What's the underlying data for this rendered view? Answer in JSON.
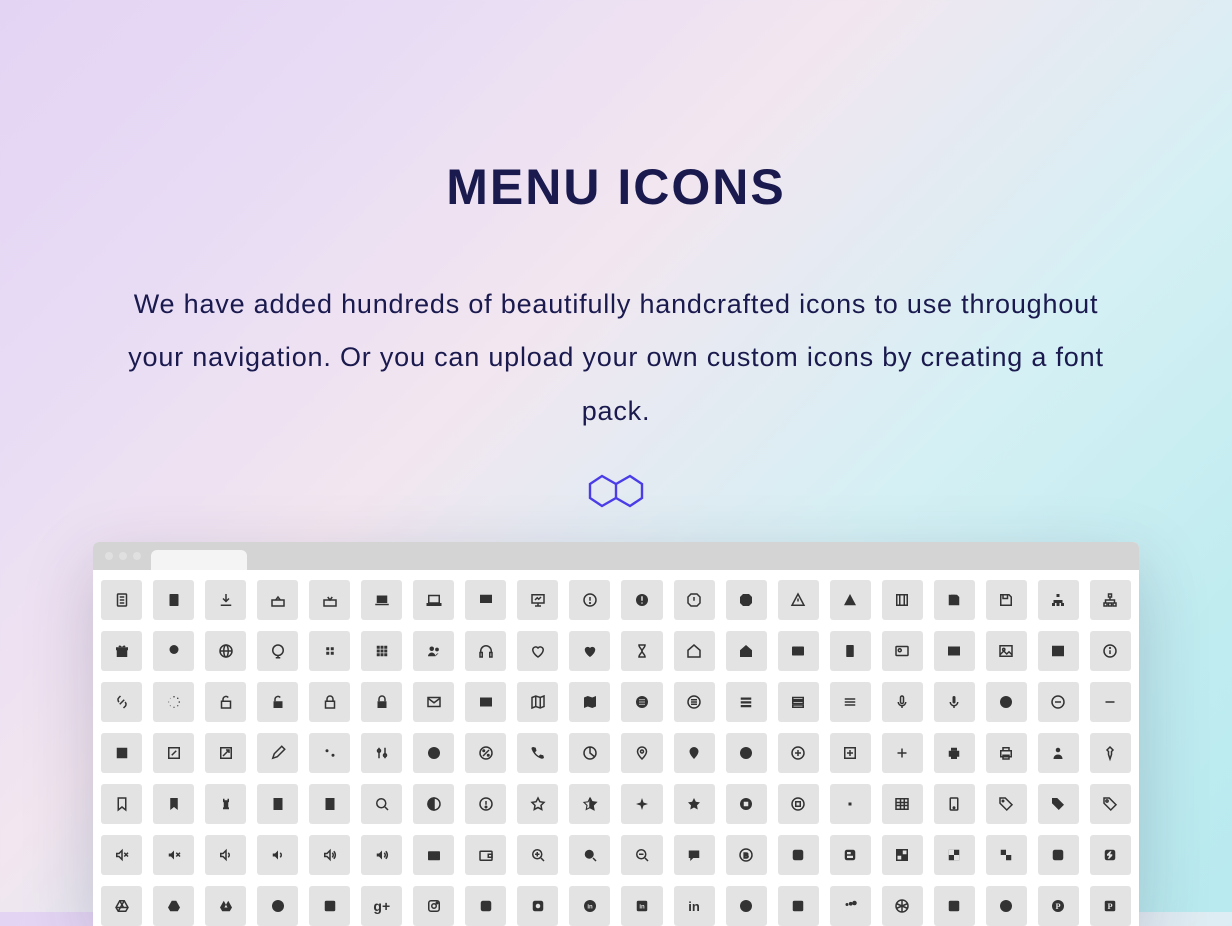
{
  "hero": {
    "title": "MENU ICONS",
    "subtitle": "We have added hundreds of beautifully handcrafted icons to use throughout your navigation. Or you can upload your own custom icons by creating a font pack."
  },
  "icons": [
    [
      "document-outline",
      "document-fill",
      "download",
      "inbox-out",
      "inbox-in",
      "laptop-fill",
      "laptop-line",
      "presentation-fill",
      "presentation-line",
      "alert-circle-line",
      "alert-circle-fill",
      "alert-octagon-line",
      "alert-octagon-fill",
      "warning-line",
      "warning-fill",
      "film",
      "save",
      "save-alt",
      "sitemap-fill",
      "sitemap-line"
    ],
    [
      "gift",
      "globe-stand",
      "globe-lines",
      "globe-round",
      "grid-small",
      "grid-large",
      "users",
      "headphones",
      "heart-line",
      "heart-fill",
      "hourglass",
      "home-line",
      "home-fill",
      "id-card",
      "id-badge",
      "id-card-alt",
      "news",
      "image-line",
      "image-fill",
      "info-circle"
    ],
    [
      "link",
      "loading",
      "lock-open-line",
      "lock-open-fill",
      "lock-closed-line",
      "lock-closed-fill",
      "mail-line",
      "mail-fill",
      "map-line",
      "map-fill",
      "menu-circle",
      "menu-lines-circle",
      "menu-bars-fill",
      "menu-bars-line",
      "menu-hamburger",
      "mic-line",
      "mic-fill",
      "minus-circle-fill",
      "minus-circle-line",
      "minus"
    ],
    [
      "expand-fill",
      "expand-line",
      "arrow-diag",
      "pencil",
      "sliders-fill",
      "sliders-line",
      "percent-fill",
      "percent-line",
      "phone",
      "pie-chart",
      "pin-line",
      "pin-fill",
      "plus-circle-fill",
      "plus-circle-line",
      "plus-square",
      "plus",
      "printer-fill",
      "printer-line",
      "person",
      "pushpin"
    ],
    [
      "bookmark-line",
      "bookmark-fill",
      "chess-rook",
      "book-check",
      "book-plus",
      "search",
      "globe-half",
      "warning-circle",
      "star-line",
      "star-half",
      "star-point",
      "star-fill",
      "stop-circle-fill",
      "stop-circle-line",
      "dot-square",
      "table",
      "tablet",
      "tag-line",
      "tag-fill",
      "tag-alt"
    ],
    [
      "volume-mute",
      "volume-mute-fill",
      "volume-low-line",
      "volume-low-fill",
      "volume-high-line",
      "volume-high-fill",
      "wallet",
      "wallet-alt",
      "zoom-in-line",
      "zoom-in-fill",
      "zoom-out",
      "chat",
      "blogger-line",
      "blogger-fill",
      "blogger-alt",
      "delicious-line",
      "delicious-fill",
      "delicious-alt",
      "deviantart-fill",
      "deviantart-alt"
    ],
    [
      "drive-line",
      "drive-fill",
      "drive-solid",
      "gplus-circle",
      "gplus-square",
      "gplus",
      "instagram-line",
      "instagram-fill",
      "instagram-alt",
      "linkedin-circle",
      "linkedin-square",
      "linkedin",
      "meetup",
      "myspace",
      "myspace-alt",
      "picasa-line",
      "picasa-fill",
      "picasa-alt",
      "pinterest-circle",
      "pinterest-square"
    ]
  ]
}
